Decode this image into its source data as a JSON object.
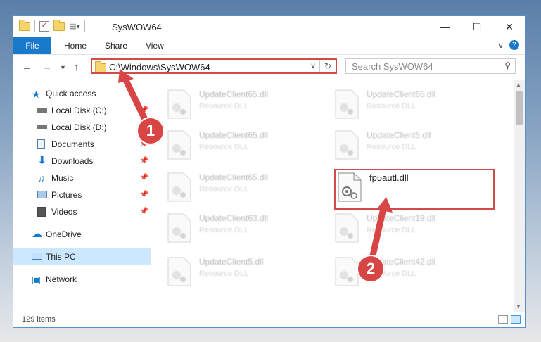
{
  "window": {
    "title": "SysWOW64"
  },
  "ribbon": {
    "tabs": [
      "File",
      "Home",
      "Share",
      "View"
    ]
  },
  "address": {
    "path": "C:\\Windows\\SysWOW64"
  },
  "search": {
    "placeholder": "Search SysWOW64"
  },
  "sidebar": {
    "items": [
      {
        "label": "Quick access",
        "icon": "star-icon"
      },
      {
        "label": "Local Disk (C:)",
        "icon": "drive-icon"
      },
      {
        "label": "Local Disk (D:)",
        "icon": "drive-icon"
      },
      {
        "label": "Documents",
        "icon": "documents-icon"
      },
      {
        "label": "Downloads",
        "icon": "downloads-icon"
      },
      {
        "label": "Music",
        "icon": "music-icon"
      },
      {
        "label": "Pictures",
        "icon": "pictures-icon"
      },
      {
        "label": "Videos",
        "icon": "videos-icon"
      },
      {
        "label": "OneDrive",
        "icon": "cloud-icon"
      },
      {
        "label": "This PC",
        "icon": "computer-icon"
      },
      {
        "label": "Network",
        "icon": "network-icon"
      }
    ]
  },
  "files": [
    {
      "name": "UpdateClient65.dll",
      "type": "Resource DLL"
    },
    {
      "name": "UpdateClient65.dll",
      "type": "Resource DLL"
    },
    {
      "name": "UpdateClient65.dll",
      "type": "Resource DLL"
    },
    {
      "name": "UpdateClient5.dll",
      "type": "Resource DLL"
    },
    {
      "name": "UpdateClient65.dll",
      "type": "Resource DLL"
    },
    {
      "name": "fp5autl.dll",
      "type": ""
    },
    {
      "name": "UpdateClient63.dll",
      "type": "Resource DLL"
    },
    {
      "name": "UpdateClient19.dll",
      "type": "Resource DLL"
    },
    {
      "name": "UpdateClient5.dll",
      "type": "Resource DLL"
    },
    {
      "name": "UpdateClient42.dll",
      "type": "Resource DLL"
    }
  ],
  "status": {
    "count": "129 items"
  },
  "callouts": {
    "one": "1",
    "two": "2"
  },
  "colors": {
    "accent": "#1979ca",
    "highlight": "#d24b4b",
    "selected": "#cce8ff"
  }
}
